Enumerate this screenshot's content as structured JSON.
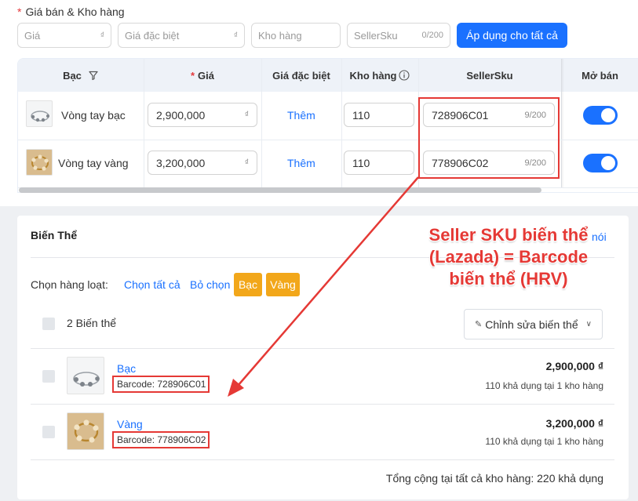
{
  "top": {
    "section_title": "Giá bán & Kho hàng",
    "required_mark": "*",
    "filters": {
      "price_placeholder": "Giá",
      "special_price_placeholder": "Giá đặc biệt",
      "stock_placeholder": "Kho hàng",
      "sellersku_placeholder": "SellerSku",
      "sellersku_counter": "0/200",
      "currency_suffix": "₫"
    },
    "apply_button": "Áp dụng cho tất cả",
    "table": {
      "headers": {
        "variant": "Bạc",
        "price": "Giá",
        "special_price": "Giá đặc biệt",
        "stock": "Kho hàng",
        "sellersku": "SellerSku",
        "on_sale": "Mở bán"
      },
      "rows": [
        {
          "name": "Vòng tay bạc",
          "price": "2,900,000",
          "special": "Thêm",
          "stock": "110",
          "sku": "728906C01",
          "sku_count": "9/200",
          "enabled": true
        },
        {
          "name": "Vòng tay vàng",
          "price": "3,200,000",
          "special": "Thêm",
          "stock": "110",
          "sku": "778906C02",
          "sku_count": "9/200",
          "enabled": true
        }
      ]
    }
  },
  "annotation": {
    "line1": "Seller SKU biến thể",
    "line2": "(Lazada) = Barcode",
    "line3": "biến thể (HRV)"
  },
  "bottom": {
    "title": "Biến Thể",
    "link_partial": "nói",
    "bulk_label": "Chọn hàng loạt:",
    "select_all": "Chọn tất cả",
    "deselect": "Bỏ chọn",
    "chips": [
      "Bạc",
      "Vàng"
    ],
    "variant_count": "2 Biến thể",
    "edit_button": "Chỉnh sửa biến thể",
    "variants": [
      {
        "name": "Bạc",
        "barcode": "Barcode: 728906C01",
        "price": "2,900,000 ₫",
        "stock": "110 khả dụng tại 1 kho hàng"
      },
      {
        "name": "Vàng",
        "barcode": "Barcode: 778906C02",
        "price": "3,200,000 ₫",
        "stock": "110 khả dụng tại 1 kho hàng"
      }
    ],
    "total": "Tổng cộng tại tất cả kho hàng: 220 khả dụng"
  },
  "colors": {
    "accent": "#1a71ff",
    "highlight": "#e53935",
    "chip": "#f2a71a"
  }
}
